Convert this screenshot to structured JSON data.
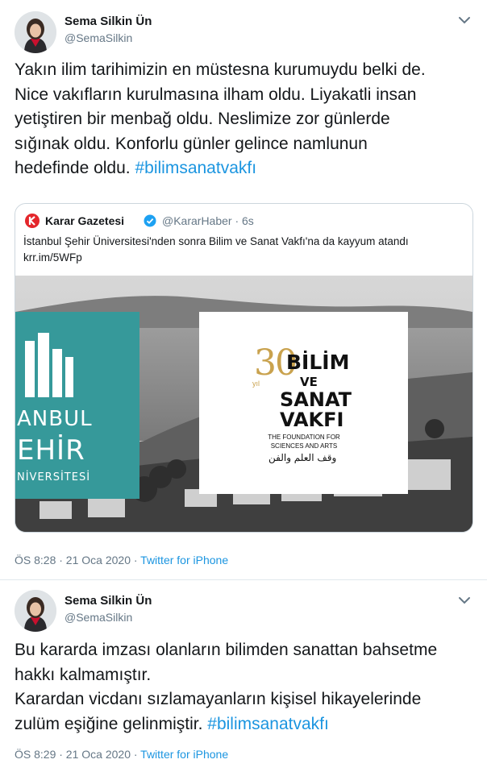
{
  "tweets": [
    {
      "author_name": "Sema Silkin Ün",
      "author_handle": "@SemaSilkin",
      "text_lines": [
        "Yakın ilim tarihimizin en müstesna kurumuydu belki de.",
        "Nice vakıfların kurulmasına ilham oldu. Liyakatli insan",
        "yetiştiren bir menbağ oldu. Neslimize zor günlerde",
        "sığınak oldu. Konforlu günler gelince namlunun",
        "hedefinde oldu. "
      ],
      "hashtag": "#bilimsanatvakfı",
      "time": "ÖS 8:28 · 21 Oca 2020 · ",
      "source": "Twitter for iPhone"
    },
    {
      "author_name": "Sema Silkin Ün",
      "author_handle": "@SemaSilkin",
      "text_lines": [
        "Bu kararda imzası olanların bilimden sanattan bahsetme",
        "hakkı kalmamıştır.",
        "Karardan vicdanı sızlamayanların kişisel hikayelerinde",
        "zulüm eşiğine gelinmiştir. "
      ],
      "hashtag": "#bilimsanatvakfı",
      "time": "ÖS 8:29 · 21 Oca 2020 · ",
      "source": "Twitter for iPhone"
    }
  ],
  "quote": {
    "author_name": "Karar Gazetesi",
    "author_handle": "@KararHaber · 6s",
    "text": "İstanbul Şehir Üniversitesi'nden sonra Bilim ve Sanat Vakfı'na da kayyum atandı",
    "link": "krr.im/5WFp",
    "image": {
      "left_text_1": "ANBUL",
      "left_text_2": "EHİR",
      "left_text_3": "NİVERSİTESİ",
      "logo_number": "30",
      "logo_yil": "yıl",
      "logo_word_1": "BİLİM",
      "logo_word_2": "VE",
      "logo_word_3": "SANAT",
      "logo_word_4": "VAKFI",
      "logo_tagline_1": "THE FOUNDATION FOR",
      "logo_tagline_2": "SCIENCES AND ARTS",
      "logo_arabic": "وقف العلم والفن"
    }
  },
  "icons": {
    "chevron": "chevron-down-icon",
    "verified": "verified-badge-icon",
    "karar_logo": "karar-logo-icon"
  },
  "colors": {
    "link": "#1b95e0",
    "muted": "#657786",
    "teal": "#36999a",
    "gold": "#c9a24e",
    "karar_red": "#e4262b"
  }
}
